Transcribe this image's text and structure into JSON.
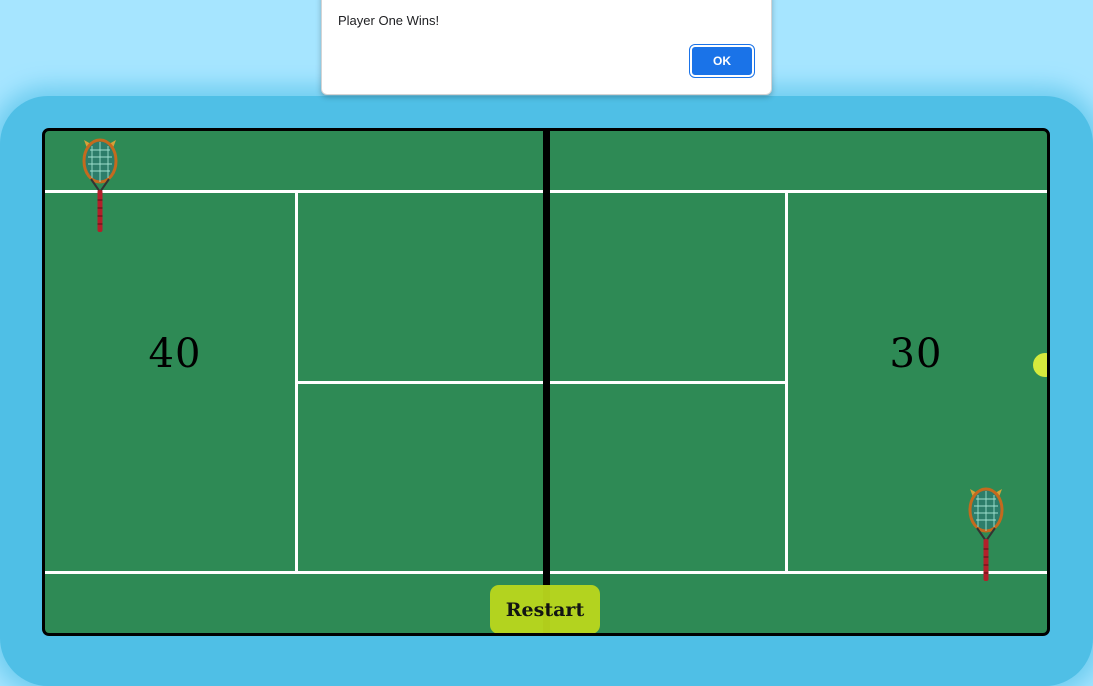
{
  "dialog": {
    "message": "Player One Wins!",
    "ok_label": "OK"
  },
  "scores": {
    "player_one": "40",
    "player_two": "30"
  },
  "controls": {
    "restart_label": "Restart"
  },
  "colors": {
    "court": "#2e8a55",
    "frame": "#4fbfe6",
    "page_background": "#a6e5ff",
    "ball": "#d6ea3d",
    "restart_button": "#b9d61d",
    "dialog_button": "#1a73e8"
  },
  "icons": {
    "racket": "tennis-racket-icon",
    "ball": "tennis-ball"
  }
}
